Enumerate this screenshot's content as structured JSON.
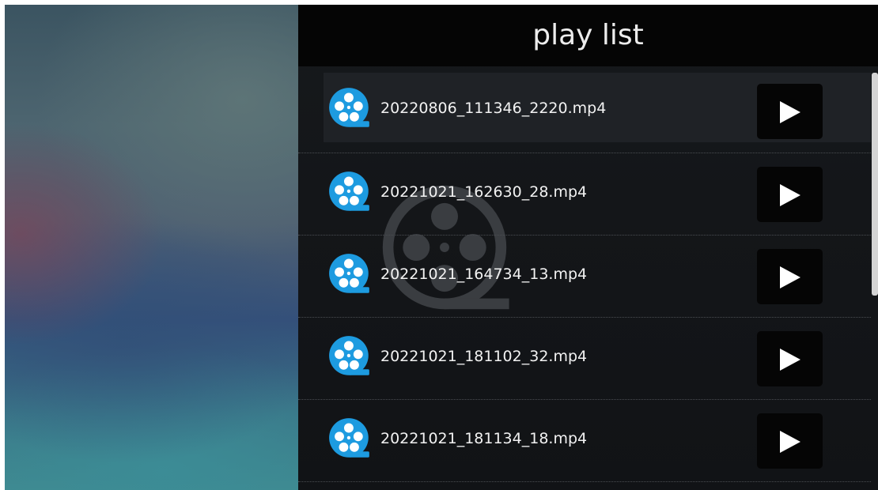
{
  "header": {
    "title": "play list"
  },
  "playlist": {
    "items": [
      {
        "name": "20220806_111346_2220.mp4",
        "selected": true
      },
      {
        "name": "20221021_162630_28.mp4",
        "selected": false
      },
      {
        "name": "20221021_164734_13.mp4",
        "selected": false
      },
      {
        "name": "20221021_181102_32.mp4",
        "selected": false
      },
      {
        "name": "20221021_181134_18.mp4",
        "selected": false
      }
    ]
  },
  "icons": {
    "file": "video-reel-icon",
    "play": "play-icon",
    "watermark": "video-reel-watermark-icon"
  },
  "colors": {
    "accent": "#1d9be0",
    "header_bg": "#050505",
    "panel_bg": "#141619",
    "text": "#f2f2f2"
  }
}
